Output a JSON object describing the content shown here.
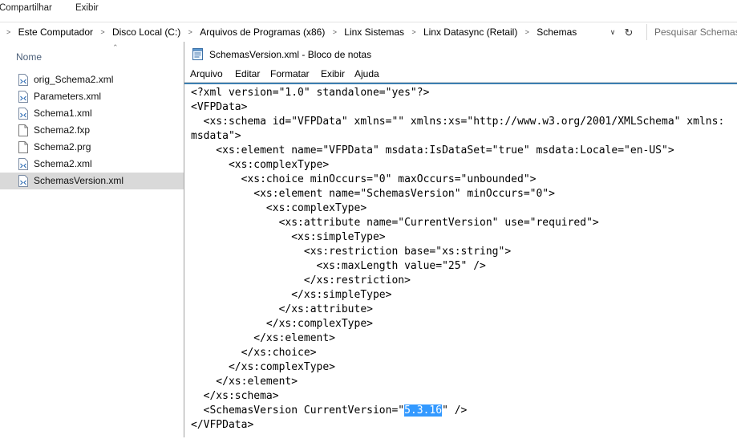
{
  "ribbon": {
    "tabs": [
      "Compartilhar",
      "Exibir"
    ]
  },
  "address_bar": {
    "breadcrumbs": [
      "Este Computador",
      "Disco Local (C:)",
      "Arquivos de Programas (x86)",
      "Linx Sistemas",
      "Linx Datasync (Retail)",
      "Schemas"
    ],
    "separator": ">",
    "dropdown_icon": "chevron-down-icon",
    "refresh_icon": "refresh-icon",
    "search_placeholder": "Pesquisar Schemas"
  },
  "file_pane": {
    "column_header": "Nome",
    "files": [
      {
        "name": "orig_Schema2.xml",
        "icon": "xml-file-icon",
        "selected": false
      },
      {
        "name": "Parameters.xml",
        "icon": "xml-file-icon",
        "selected": false
      },
      {
        "name": "Schema1.xml",
        "icon": "xml-file-icon",
        "selected": false
      },
      {
        "name": "Schema2.fxp",
        "icon": "blank-file-icon",
        "selected": false
      },
      {
        "name": "Schema2.prg",
        "icon": "blank-file-icon",
        "selected": false
      },
      {
        "name": "Schema2.xml",
        "icon": "xml-file-icon",
        "selected": false
      },
      {
        "name": "SchemasVersion.xml",
        "icon": "xml-file-icon",
        "selected": true
      }
    ]
  },
  "notepad": {
    "title": "SchemasVersion.xml - Bloco de notas",
    "menus": [
      "Arquivo",
      "Editar",
      "Formatar",
      "Exibir",
      "Ajuda"
    ],
    "lines": [
      "<?xml version=\"1.0\" standalone=\"yes\"?>",
      "<VFPData>",
      "  <xs:schema id=\"VFPData\" xmlns=\"\" xmlns:xs=\"http://www.w3.org/2001/XMLSchema\" xmlns:",
      "msdata\">",
      "    <xs:element name=\"VFPData\" msdata:IsDataSet=\"true\" msdata:Locale=\"en-US\">",
      "      <xs:complexType>",
      "        <xs:choice minOccurs=\"0\" maxOccurs=\"unbounded\">",
      "          <xs:element name=\"SchemasVersion\" minOccurs=\"0\">",
      "            <xs:complexType>",
      "              <xs:attribute name=\"CurrentVersion\" use=\"required\">",
      "                <xs:simpleType>",
      "                  <xs:restriction base=\"xs:string\">",
      "                    <xs:maxLength value=\"25\" />",
      "                  </xs:restriction>",
      "                </xs:simpleType>",
      "              </xs:attribute>",
      "            </xs:complexType>",
      "          </xs:element>",
      "        </xs:choice>",
      "      </xs:complexType>",
      "    </xs:element>",
      "  </xs:schema>"
    ],
    "version_line_prefix": "  <SchemasVersion CurrentVersion=\"",
    "selected_text": "5.3.16",
    "version_line_suffix": "\" />",
    "last_line": "</VFPData>",
    "selection_color": "#3399ff",
    "caret_border_color": "#3c7fb1"
  }
}
